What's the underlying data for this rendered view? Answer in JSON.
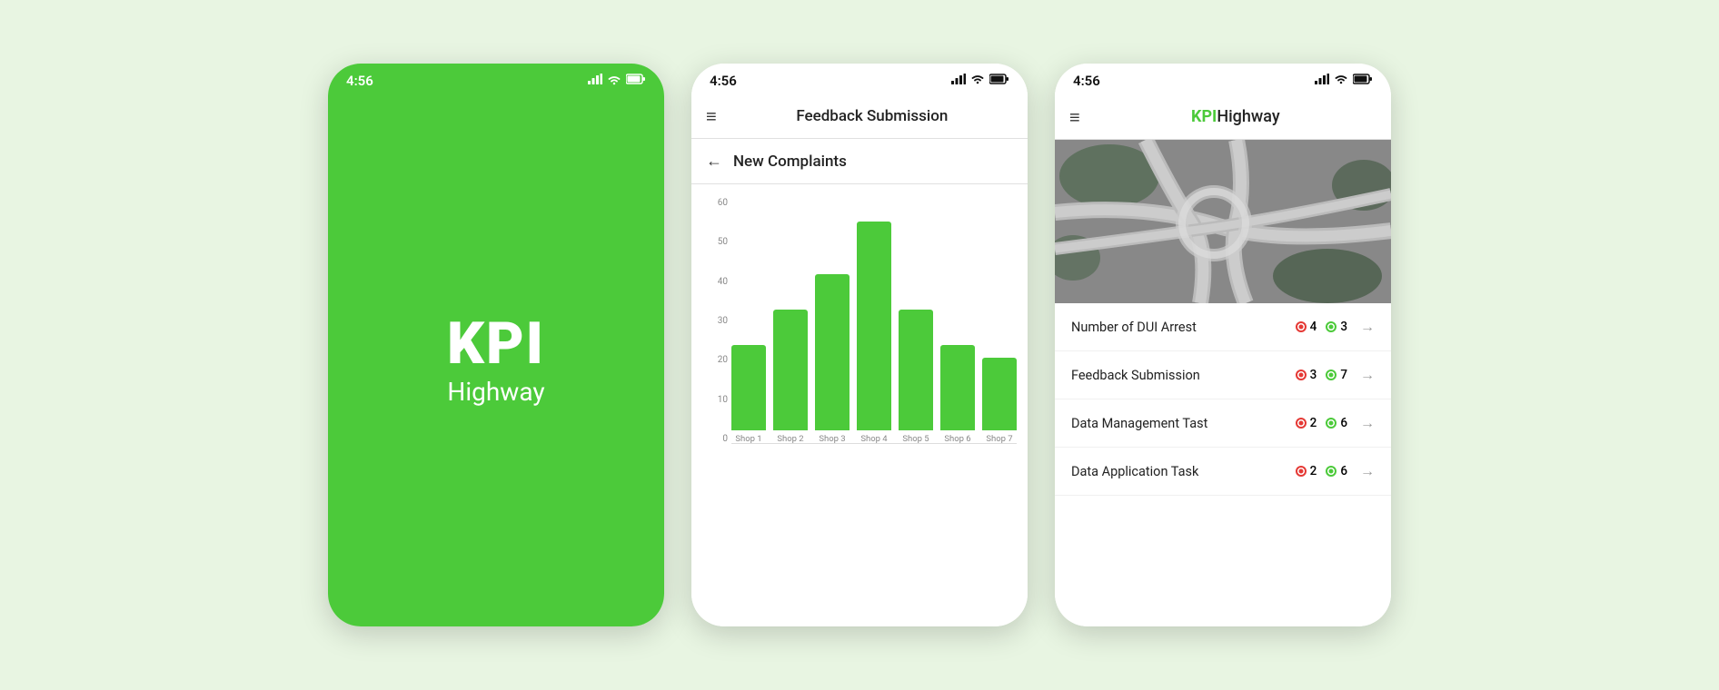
{
  "screens": {
    "splash": {
      "statusBar": {
        "time": "4:56",
        "signal": "▌▌▌",
        "wifi": "▲",
        "battery": "▓"
      },
      "logo": {
        "kpi": "KPI",
        "highway": "Highway"
      }
    },
    "chart": {
      "statusBar": {
        "time": "4:56"
      },
      "navTitle": "Feedback Submission",
      "subNavTitle": "New Complaints",
      "chartYLabels": [
        "60",
        "50",
        "40",
        "30",
        "20",
        "10",
        "0"
      ],
      "bars": [
        {
          "label": "Shop 1",
          "value": 25,
          "heightPct": 41
        },
        {
          "label": "Shop 2",
          "value": 35,
          "heightPct": 58
        },
        {
          "label": "Shop 3",
          "value": 45,
          "heightPct": 75
        },
        {
          "label": "Shop 4",
          "value": 60,
          "heightPct": 100
        },
        {
          "label": "Shop 5",
          "value": 35,
          "heightPct": 58
        },
        {
          "label": "Shop 6",
          "value": 25,
          "heightPct": 41
        },
        {
          "label": "Shop 7",
          "value": 21,
          "heightPct": 35
        }
      ]
    },
    "dashboard": {
      "statusBar": {
        "time": "4:56"
      },
      "brand": {
        "kpi": "KPI",
        "highway": "Highway"
      },
      "metrics": [
        {
          "label": "Number of DUI Arrest",
          "redCount": "4",
          "greenCount": "3"
        },
        {
          "label": "Feedback Submission",
          "redCount": "3",
          "greenCount": "7"
        },
        {
          "label": "Data Management Tast",
          "redCount": "2",
          "greenCount": "6"
        },
        {
          "label": "Data Application Task",
          "redCount": "2",
          "greenCount": "6"
        }
      ]
    }
  },
  "icons": {
    "hamburger": "≡",
    "backArrow": "←",
    "arrowRight": "→",
    "signal": "📶",
    "wifi": "WiFi",
    "battery": "🔋"
  }
}
